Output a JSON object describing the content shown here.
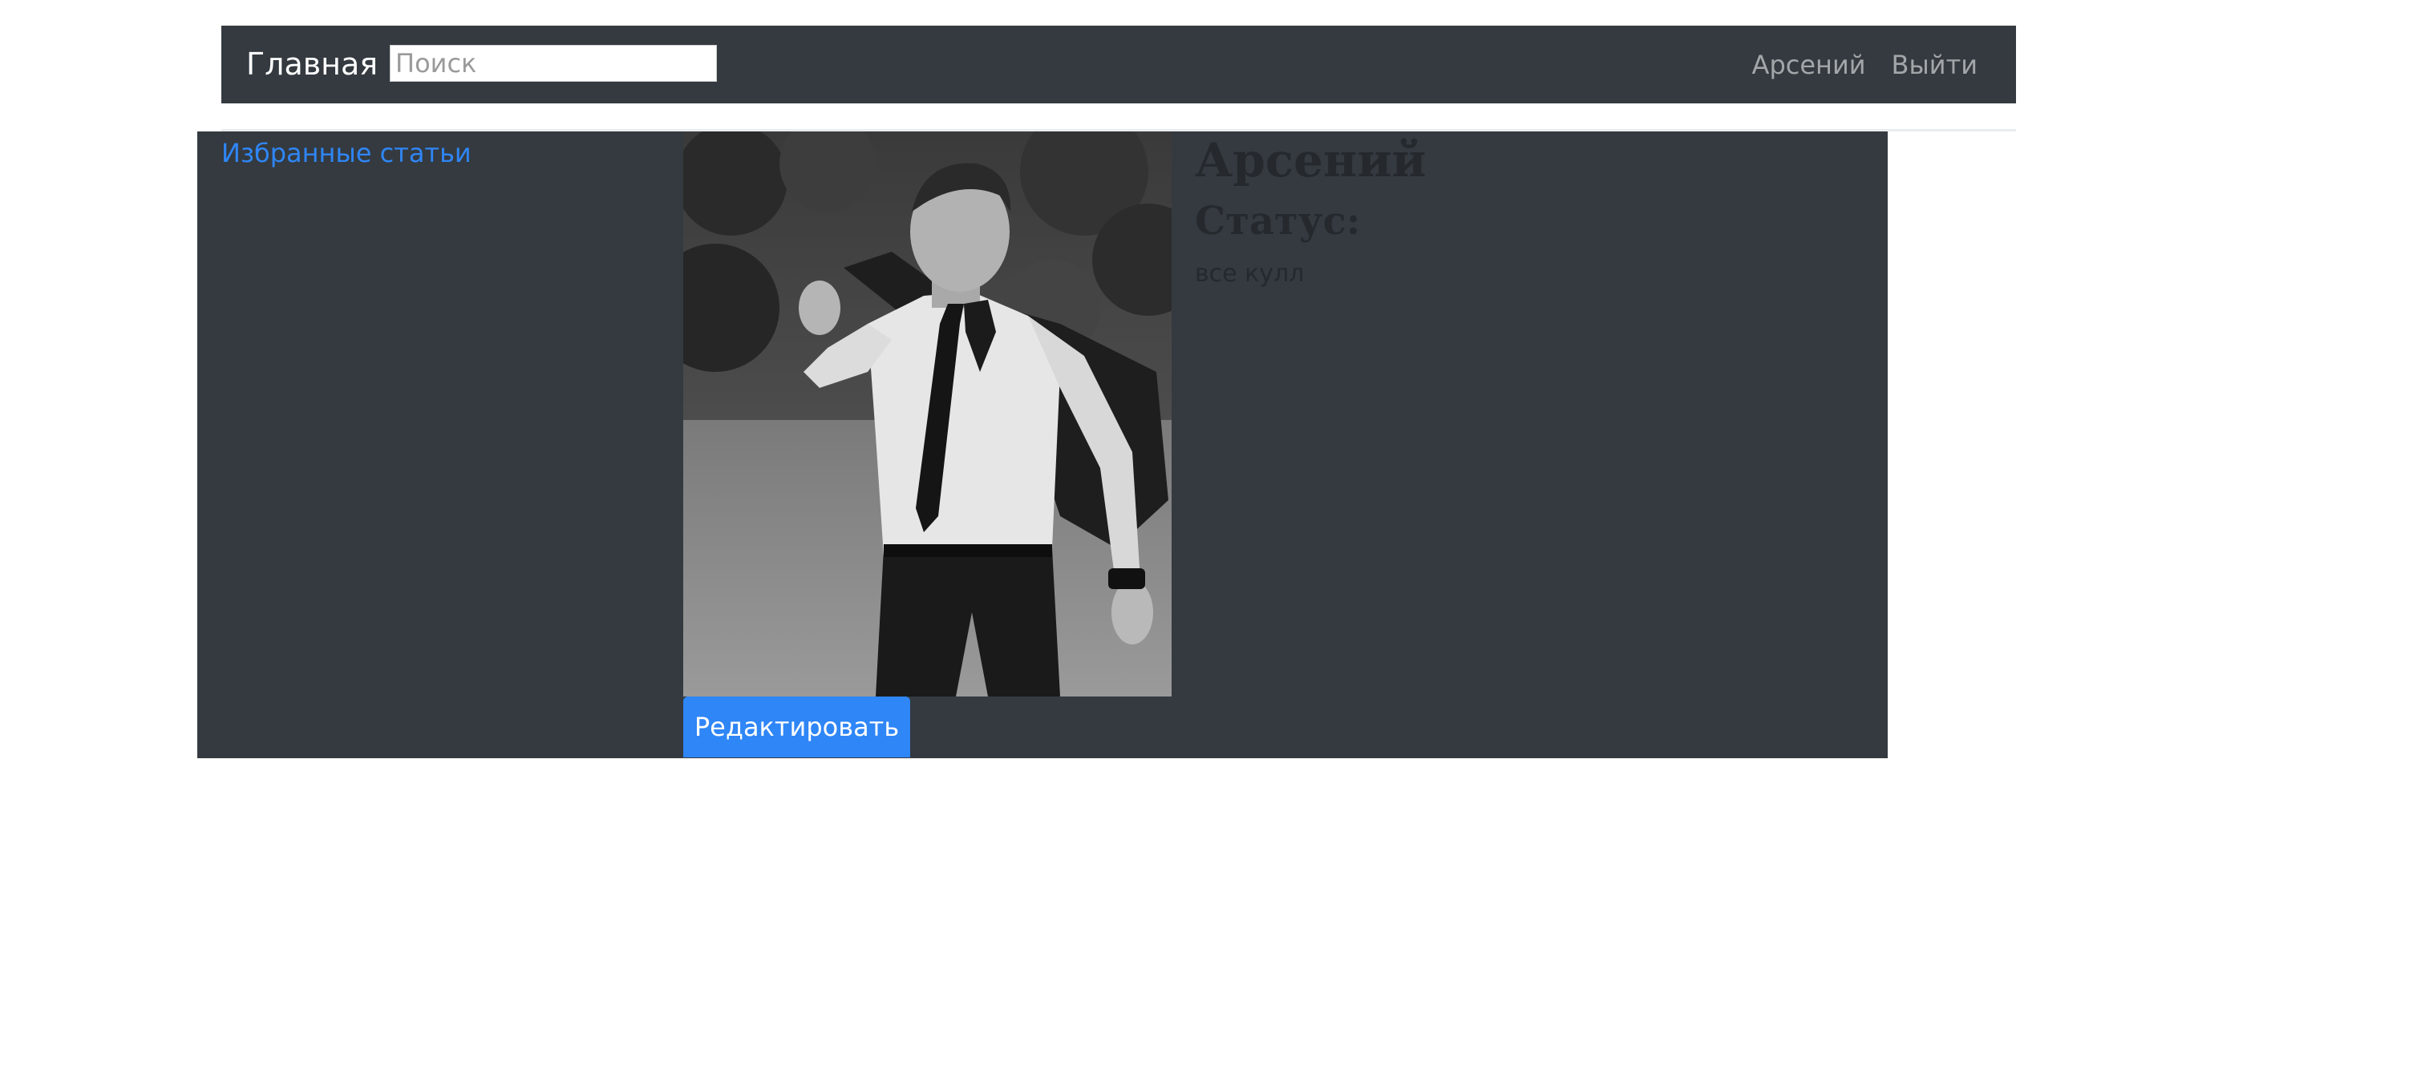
{
  "navbar": {
    "brand": "Главная",
    "search_placeholder": "Поиск",
    "search_value": "",
    "user_link": "Арсений",
    "logout_link": "Выйти"
  },
  "sidebar": {
    "favorites_link": "Избранные статьи"
  },
  "profile": {
    "photo_icon": "profile-photo",
    "name": "Арсений",
    "status_label": "Статус:",
    "status_text": "все кулл",
    "edit_button": "Редактировать"
  },
  "colors": {
    "navbar_bg": "#343a40",
    "panel_bg": "#343a40",
    "link_blue": "#2f86f6",
    "button_blue": "#2f86f6",
    "heading_dark": "#25292d"
  }
}
